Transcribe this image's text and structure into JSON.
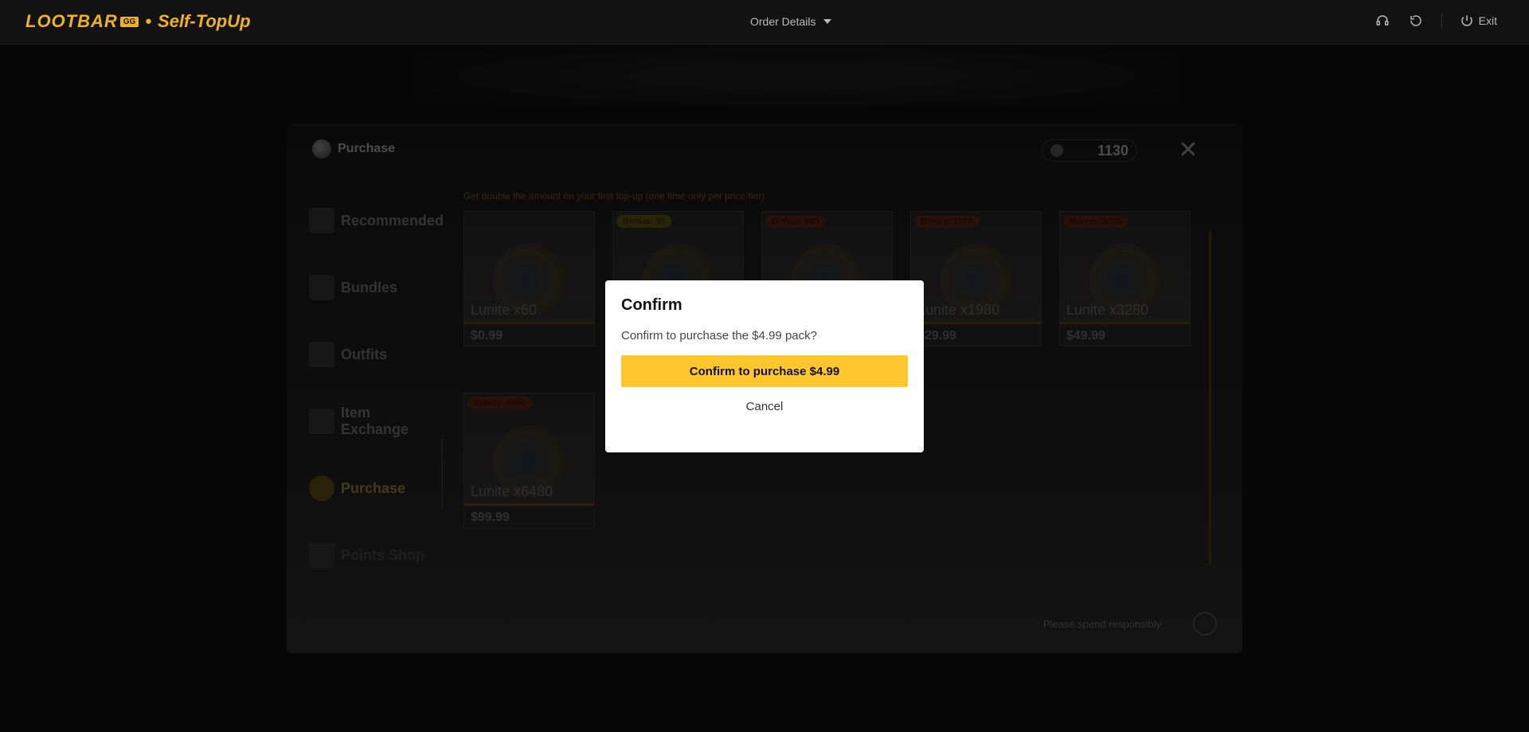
{
  "header": {
    "brand_logo": "LOOTBAR",
    "brand_badge": "GG",
    "brand_separator": "•",
    "brand_subtitle": "Self-TopUp",
    "order_details": "Order Details",
    "exit_label": "Exit",
    "icons": [
      "headset-icon",
      "refresh-icon",
      "power-icon"
    ]
  },
  "game": {
    "title": "Purchase",
    "currency_amount": "1130",
    "notice": "Get double the amount on your first top-up (one time only per price tier)",
    "sidebar": [
      {
        "label": "Recommended"
      },
      {
        "label": "Bundles"
      },
      {
        "label": "Outfits"
      },
      {
        "label": "Item Exchange"
      },
      {
        "label": "Purchase"
      },
      {
        "label": "Points Shop"
      }
    ],
    "cards": [
      {
        "bonus": "",
        "name": "Lunite x60",
        "price": "$0.99"
      },
      {
        "bonus": "Bonus: 30",
        "name": "",
        "price": ""
      },
      {
        "bonus": "Bonus: 980",
        "name": "",
        "price": ""
      },
      {
        "bonus": "Bonus: 1980",
        "name": "Lunite x1980",
        "price": "$29.99"
      },
      {
        "bonus": "Bonus: 3280",
        "name": "Lunite x3280",
        "price": "$49.99"
      },
      {
        "bonus": "Bonus: 6480",
        "name": "Lunite x6480",
        "price": "$99.99"
      }
    ],
    "spend_notice": "Please spend responsibly"
  },
  "modal": {
    "title": "Confirm",
    "message": "Confirm to purchase the $4.99 pack?",
    "confirm_label": "Confirm to purchase $4.99",
    "cancel_label": "Cancel"
  },
  "colors": {
    "accent": "#ffc72c",
    "brand": "#f2b21c"
  }
}
